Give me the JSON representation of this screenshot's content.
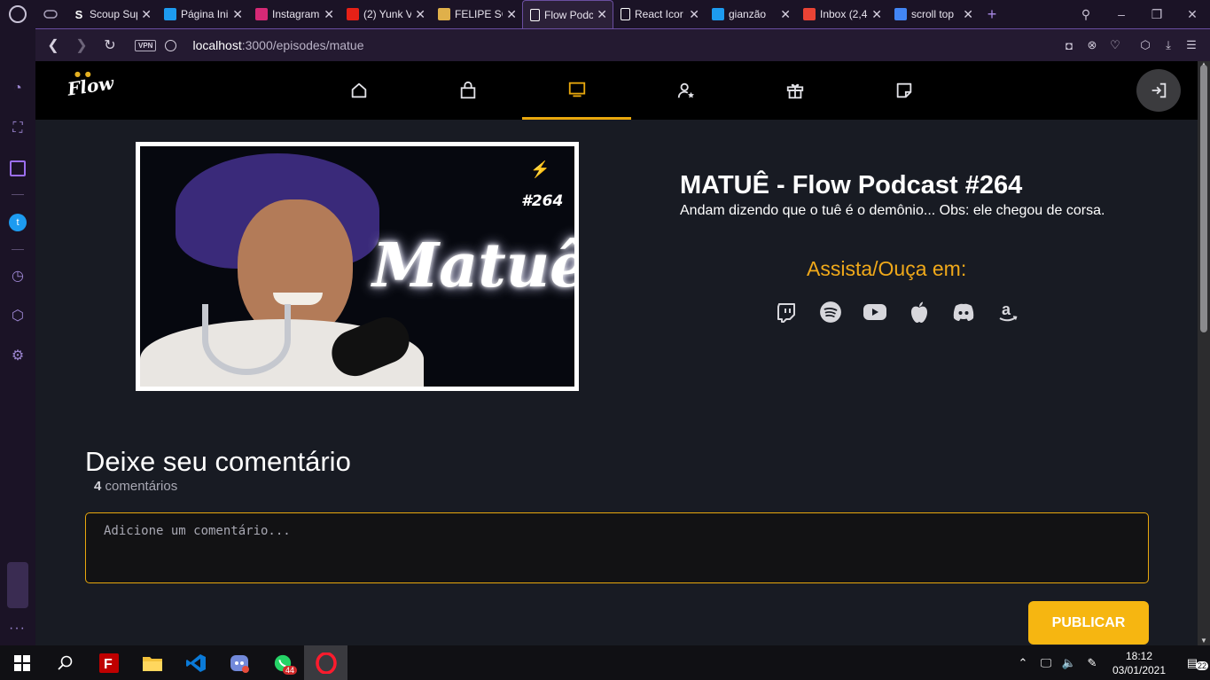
{
  "browser": {
    "tabs": [
      {
        "label": "Scoup Sup",
        "favicon": "S",
        "fav_color": "#1b1326"
      },
      {
        "label": "Página Ini",
        "favicon": "twitter-icon",
        "fav_color": "#1d9bf0"
      },
      {
        "label": "Instagram",
        "favicon": "instagram-icon",
        "fav_color": "#d62976"
      },
      {
        "label": "(2) Yunk V",
        "favicon": "youtube-icon",
        "fav_color": "#e62117"
      },
      {
        "label": "FELIPE SO",
        "favicon": "bookmark-icon",
        "fav_color": "#e0b04a"
      },
      {
        "label": "Flow Podc",
        "favicon": "page-icon",
        "fav_color": "#ffffff",
        "active": true
      },
      {
        "label": "React Icor",
        "favicon": "page-icon",
        "fav_color": "#ffffff"
      },
      {
        "label": "gianzão",
        "favicon": "twitter-icon",
        "fav_color": "#1d9bf0"
      },
      {
        "label": "Inbox (2,4",
        "favicon": "gmail-icon",
        "fav_color": "#ea4335"
      },
      {
        "label": "scroll top",
        "favicon": "google-icon",
        "fav_color": "#4285f4"
      }
    ],
    "new_tab": "+",
    "url_host": "localhost",
    "url_path": ":3000/episodes/matue",
    "vpn_label": "VPN"
  },
  "site": {
    "logo": "Flow",
    "nav": [
      "home-icon",
      "shop-icon",
      "episodes-icon",
      "guests-icon",
      "gifts-icon",
      "notes-icon"
    ],
    "active_nav": "episodes-icon",
    "accent": "#e8a70d"
  },
  "episode": {
    "title": "MATUÊ - Flow Podcast #264",
    "description": "Andam dizendo que o tuê é o demônio... Obs: ele chegou de corsa.",
    "thumbnail_text": "Matuê",
    "thumbnail_number": "#264",
    "watch_label": "Assista/Ouça em:",
    "platforms": [
      "twitch-icon",
      "spotify-icon",
      "youtube-icon",
      "apple-icon",
      "discord-icon",
      "amazon-icon"
    ]
  },
  "comments": {
    "heading": "Deixe seu comentário",
    "count": "4",
    "count_suffix": " comentários",
    "placeholder": "Adicione um comentário...",
    "publish_label": "PUBLICAR"
  },
  "taskbar": {
    "time": "18:12",
    "date": "03/01/2021",
    "whatsapp_badge": "44",
    "notifications": "22"
  }
}
